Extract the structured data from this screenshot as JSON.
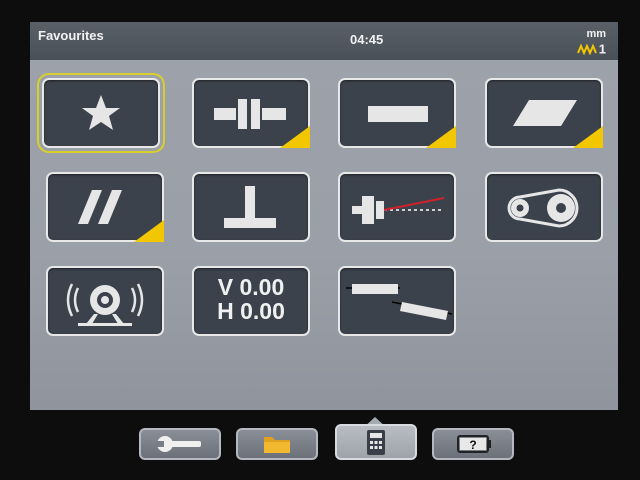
{
  "header": {
    "title": "Favourites",
    "time": "04:45",
    "unit": "mm",
    "resolution": "1"
  },
  "tiles": [
    {
      "icon": "star-icon",
      "selected": true,
      "submenu": false
    },
    {
      "icon": "coupling-icon",
      "submenu": true
    },
    {
      "icon": "straightness-icon",
      "submenu": true
    },
    {
      "icon": "flatness-icon",
      "submenu": true
    },
    {
      "icon": "parallelism-icon",
      "submenu": true
    },
    {
      "icon": "perpendicularity-icon",
      "submenu": false
    },
    {
      "icon": "spindle-laser-icon",
      "submenu": false
    },
    {
      "icon": "belt-pulley-icon",
      "submenu": false
    },
    {
      "icon": "vibration-icon",
      "submenu": false
    },
    {
      "text_v": "V 0.00",
      "text_h": "H 0.00",
      "submenu": false
    },
    {
      "icon": "offset-shafts-icon",
      "submenu": false
    }
  ],
  "toolbar": [
    {
      "icon": "wrench-icon"
    },
    {
      "icon": "folder-icon"
    },
    {
      "icon": "calculator-icon",
      "active": true
    },
    {
      "icon": "help-battery-icon"
    }
  ],
  "colors": {
    "accent": "#f2c600",
    "selection": "#d9cf2a",
    "tile": "#3c424c"
  }
}
